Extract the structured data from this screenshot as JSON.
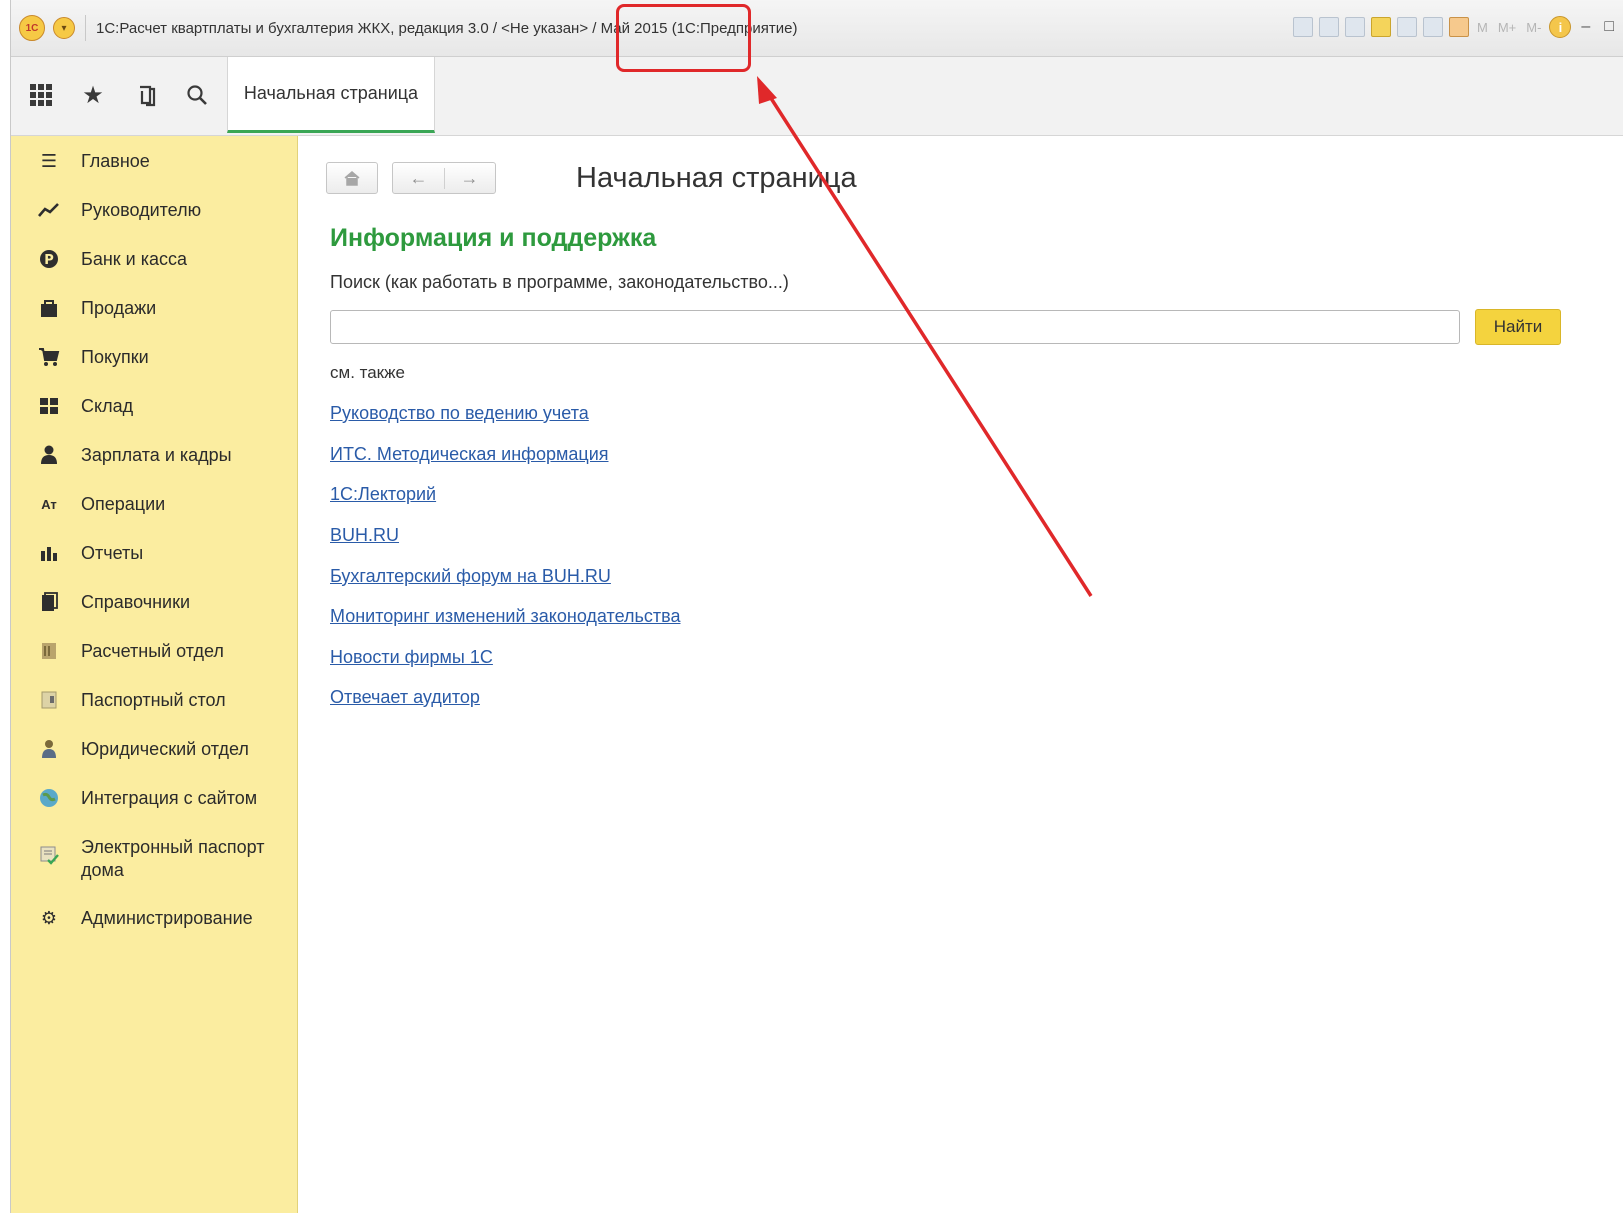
{
  "window": {
    "logo_text": "1С",
    "title": "1С:Расчет квартплаты и бухгалтерия ЖКХ, редакция 3.0 / <Не указан> / Май 2015  (1С:Предприятие)",
    "tools": [
      "M",
      "M+",
      "M-"
    ],
    "controls": {
      "minimize": "‒",
      "maximize": "□"
    }
  },
  "toolbar": {
    "tab_label": "Начальная страница"
  },
  "sidebar": {
    "items": [
      {
        "label": "Главное",
        "icon": "list-icon"
      },
      {
        "label": "Руководителю",
        "icon": "trend-icon"
      },
      {
        "label": "Банк и касса",
        "icon": "ruble-icon"
      },
      {
        "label": "Продажи",
        "icon": "bag-icon"
      },
      {
        "label": "Покупки",
        "icon": "cart-icon"
      },
      {
        "label": "Склад",
        "icon": "warehouse-icon"
      },
      {
        "label": "Зарплата и кадры",
        "icon": "person-icon"
      },
      {
        "label": "Операции",
        "icon": "operations-icon"
      },
      {
        "label": "Отчеты",
        "icon": "bar-chart-icon"
      },
      {
        "label": "Справочники",
        "icon": "book-icon"
      },
      {
        "label": "Расчетный отдел",
        "icon": "calc-dept-icon"
      },
      {
        "label": "Паспортный стол",
        "icon": "passport-icon"
      },
      {
        "label": "Юридический отдел",
        "icon": "legal-icon"
      },
      {
        "label": "Интеграция с сайтом",
        "icon": "globe-icon"
      },
      {
        "label": "Электронный паспорт дома",
        "icon": "house-passport-icon"
      },
      {
        "label": "Администрирование",
        "icon": "gear-icon"
      }
    ]
  },
  "main": {
    "page_title": "Начальная страница",
    "section_title": "Информация и поддержка",
    "search_label": "Поиск (как работать в программе, законодательство...)",
    "search_value": "",
    "search_button": "Найти",
    "see_also": "см. также",
    "links": [
      "Руководство по ведению учета",
      "ИТС. Методическая информация",
      "1С:Лекторий",
      "BUH.RU",
      "Бухгалтерский форум на BUH.RU",
      "Мониторинг изменений законодательства",
      "Новости фирмы 1С",
      "Отвечает аудитор"
    ]
  },
  "colors": {
    "sidebar_bg": "#fbeda0",
    "accent_green": "#2e9a3e",
    "link_blue": "#2a5ba8",
    "find_button": "#f4d33e",
    "annotation_red": "#e0282a"
  }
}
